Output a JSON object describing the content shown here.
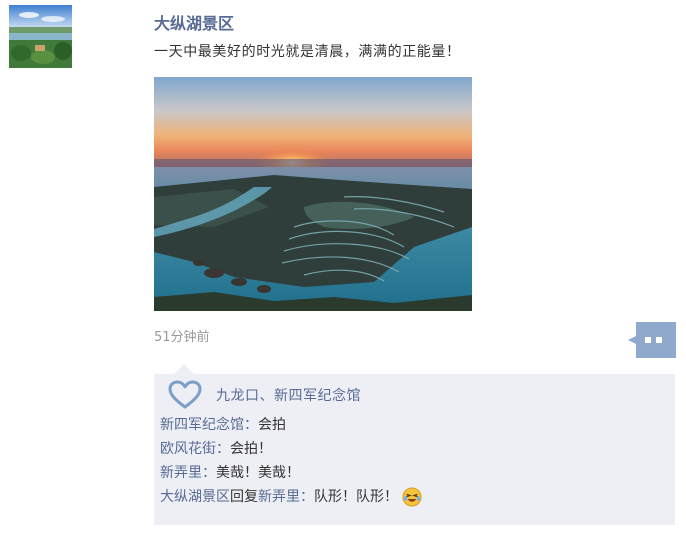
{
  "post": {
    "author": "大纵湖景区",
    "text": "一天中最美好的时光就是清晨，满满的正能量！",
    "image_description_icon": "sunrise-landscape-photo",
    "timestamp": "51分钟前"
  },
  "likes": {
    "icon": "heart-icon",
    "names": "九龙口、新四军纪念馆"
  },
  "comments": [
    {
      "name": "新四军纪念馆",
      "separator": "：",
      "text": "会拍"
    },
    {
      "name": "欧风花街",
      "separator": "：",
      "text": "会拍！"
    },
    {
      "name": "新弄里",
      "separator": "：",
      "text": "美哉！美哉！"
    },
    {
      "name": "大纵湖景区",
      "reply_word": "回复",
      "reply_to": "新弄里",
      "separator": "：",
      "text": "队形！队形！",
      "emoji": "laughing-tears-emoji"
    }
  ],
  "colors": {
    "link": "#576b95",
    "text": "#333333",
    "muted": "#999999",
    "box_bg": "#eeeff5",
    "toggle": "#8ea9cc"
  }
}
